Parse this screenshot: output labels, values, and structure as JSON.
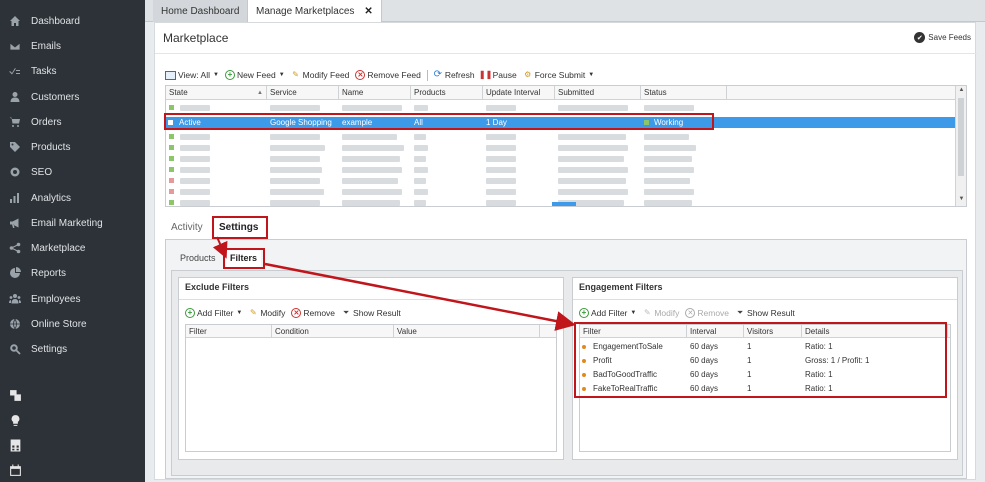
{
  "sidebar": {
    "items": [
      {
        "label": "Dashboard",
        "icon": "home-icon"
      },
      {
        "label": "Emails",
        "icon": "envelope-icon"
      },
      {
        "label": "Tasks",
        "icon": "tasks-icon"
      },
      {
        "label": "Customers",
        "icon": "user-icon"
      },
      {
        "label": "Orders",
        "icon": "cart-icon"
      },
      {
        "label": "Products",
        "icon": "tag-icon"
      },
      {
        "label": "SEO",
        "icon": "seo-icon"
      },
      {
        "label": "Analytics",
        "icon": "bar-chart-icon"
      },
      {
        "label": "Email Marketing",
        "icon": "megaphone-icon"
      },
      {
        "label": "Marketplace",
        "icon": "share-icon"
      },
      {
        "label": "Reports",
        "icon": "pie-chart-icon"
      },
      {
        "label": "Employees",
        "icon": "group-icon"
      },
      {
        "label": "Online Store",
        "icon": "globe-icon"
      },
      {
        "label": "Settings",
        "icon": "settings-search-icon"
      }
    ],
    "bottom_icons": [
      "windows-icon",
      "lightbulb-icon",
      "calculator-icon",
      "calendar-icon"
    ]
  },
  "tabs": [
    {
      "label": "Home Dashboard"
    },
    {
      "label": "Manage Marketplaces",
      "close": "✕"
    }
  ],
  "header": {
    "title": "Marketplace",
    "save_feeds": "Save Feeds"
  },
  "toolbar": {
    "view": "View: All",
    "new_feed": "New Feed",
    "modify_feed": "Modify Feed",
    "remove_feed": "Remove Feed",
    "refresh": "Refresh",
    "pause": "Pause",
    "force_submit": "Force Submit"
  },
  "feeds_grid": {
    "columns": [
      "State",
      "Service",
      "Name",
      "Products",
      "Update Interval",
      "Submitted",
      "Status"
    ],
    "selected_row": {
      "state": "Active",
      "service": "Google Shopping",
      "name": "example",
      "products": "All",
      "update_interval": "1 Day",
      "submitted": "",
      "status": "Working"
    },
    "state_colors": {
      "green": "#8cc56a",
      "red": "#e59a9a"
    }
  },
  "lower_tabs": {
    "activity": "Activity",
    "settings": "Settings"
  },
  "settings_tabs": {
    "products": "Products",
    "filters": "Filters"
  },
  "exclude_filters": {
    "title": "Exclude Filters",
    "toolbar": {
      "add_filter": "Add Filter",
      "modify": "Modify",
      "remove": "Remove",
      "show_result": "Show Result"
    },
    "columns": [
      "Filter",
      "Condition",
      "Value"
    ]
  },
  "engagement_filters": {
    "title": "Engagement Filters",
    "toolbar": {
      "add_filter": "Add Filter",
      "modify": "Modify",
      "remove": "Remove",
      "show_result": "Show Result"
    },
    "columns": [
      "Filter",
      "Interval",
      "Visitors",
      "Details"
    ],
    "rows": [
      {
        "filter": "EngagementToSale",
        "interval": "60 days",
        "visitors": "1",
        "details": "Ratio: 1"
      },
      {
        "filter": "Profit",
        "interval": "60 days",
        "visitors": "1",
        "details": "Gross: 1 / Profit: 1"
      },
      {
        "filter": "BadToGoodTraffic",
        "interval": "60 days",
        "visitors": "1",
        "details": "Ratio: 1"
      },
      {
        "filter": "FakeToRealTraffic",
        "interval": "60 days",
        "visitors": "1",
        "details": "Ratio: 1"
      }
    ]
  },
  "colors": {
    "highlight": "#c0151a",
    "selection": "#3d9ae8",
    "sidebar": "#2d3238"
  }
}
